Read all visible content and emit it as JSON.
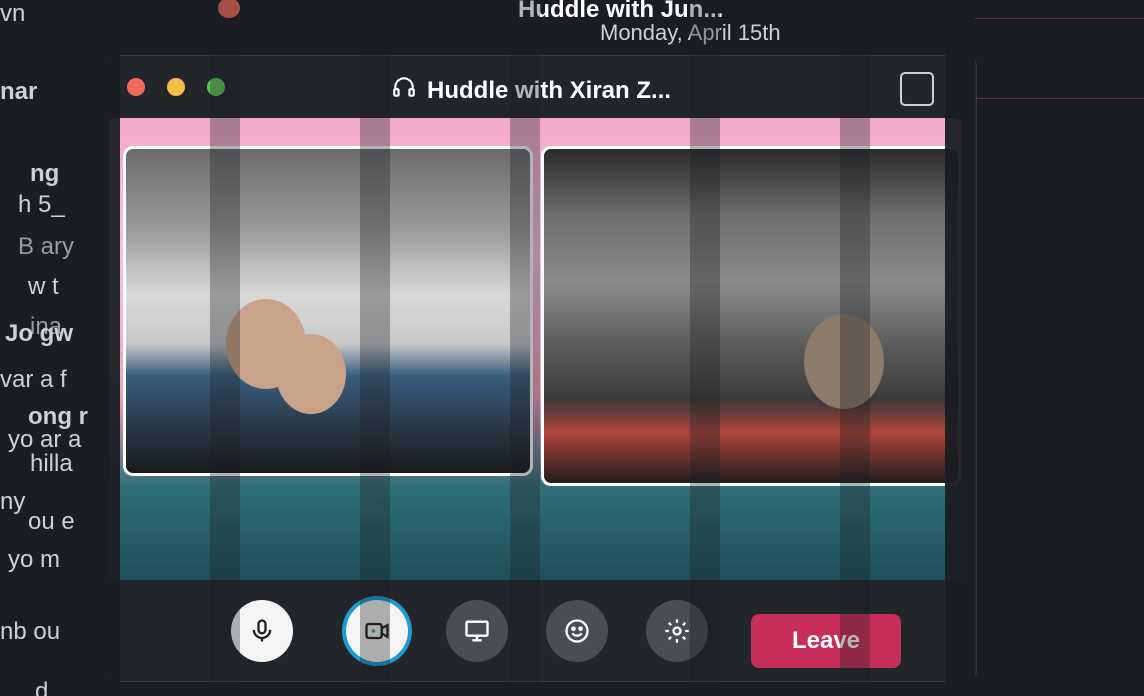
{
  "sidebar_bg": {
    "lines": [
      "vn",
      "nar",
      "ng",
      "h 5_",
      "B ary",
      "w t",
      "ina",
      "Jo gw",
      "var a f",
      "ong r",
      "yo ar a",
      "hilla",
      "ny",
      "ou e",
      "yo m",
      "nb ou",
      "d"
    ]
  },
  "window": {
    "title": "Huddle with Xiran Z...",
    "ghost_title": "Huddle with Jun...",
    "ghost_subtitle": "Monday, April 15th",
    "subtitle": "Monday, April 15th"
  },
  "controls": {
    "leave_label": "Leave",
    "mic_label": "Mute",
    "camera_label": "Camera",
    "share_label": "Share screen",
    "reactions_label": "Reactions",
    "settings_label": "Settings"
  },
  "colors": {
    "leave": "#c72f5a",
    "camera_active": "#1d9bd1",
    "background": "#1a1d21"
  },
  "icons": {
    "headphones": "headphones-icon",
    "mic": "microphone-icon",
    "camera": "video-camera-icon",
    "share": "screen-share-icon",
    "emoji": "emoji-icon",
    "settings": "gear-icon",
    "popout": "popout-icon"
  }
}
